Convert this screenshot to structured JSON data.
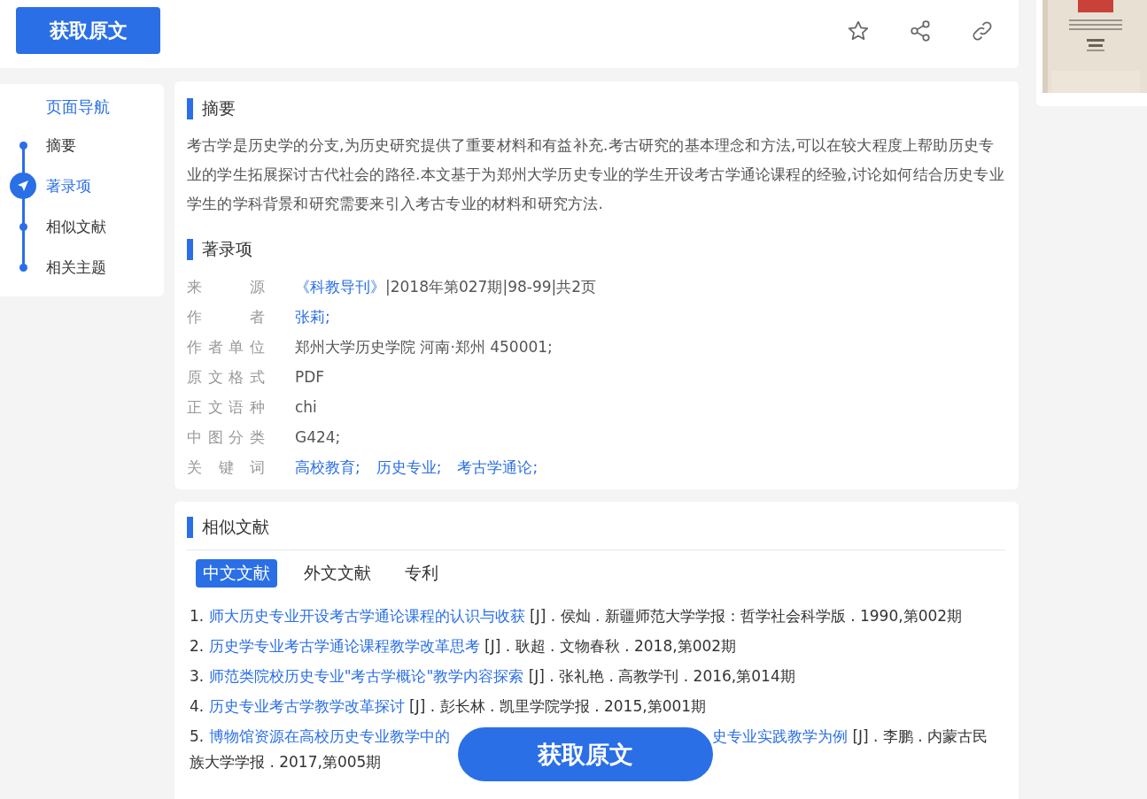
{
  "header": {
    "button": "获取原文"
  },
  "nav": {
    "title": "页面导航",
    "items": [
      {
        "label": "摘要",
        "selected": false
      },
      {
        "label": "著录项",
        "selected": true
      },
      {
        "label": "相似文献",
        "selected": false
      },
      {
        "label": "相关主题",
        "selected": false
      }
    ]
  },
  "abstract": {
    "heading": "摘要",
    "text": "考古学是历史学的分支,为历史研究提供了重要材料和有益补充.考古研究的基本理念和方法,可以在较大程度上帮助历史专业的学生拓展探讨古代社会的路径.本文基于为郑州大学历史专业的学生开设考古学通论课程的经验,讨论如何结合历史专业学生的学科背景和研究需要来引入考古专业的材料和研究方法."
  },
  "record": {
    "heading": "著录项",
    "fields": [
      {
        "label": "来源",
        "parts": [
          {
            "text": "《科教导刊》",
            "kind": "link"
          },
          {
            "text": "|2018年第027期|98-99|共2页",
            "kind": "text"
          }
        ]
      },
      {
        "label": "作者",
        "parts": [
          {
            "text": "张莉;",
            "kind": "link"
          }
        ]
      },
      {
        "label": "作者单位",
        "parts": [
          {
            "text": "郑州大学历史学院 河南·郑州 450001;",
            "kind": "text"
          }
        ]
      },
      {
        "label": "原文格式",
        "parts": [
          {
            "text": "PDF",
            "kind": "text"
          }
        ]
      },
      {
        "label": "正文语种",
        "parts": [
          {
            "text": "chi",
            "kind": "text"
          }
        ]
      },
      {
        "label": "中图分类",
        "parts": [
          {
            "text": "G424;",
            "kind": "text"
          }
        ]
      },
      {
        "label": "关键词",
        "parts": [
          {
            "text": "高校教育;",
            "kind": "link"
          },
          {
            "text": "历史专业;",
            "kind": "link"
          },
          {
            "text": "考古学通论;",
            "kind": "link"
          }
        ]
      }
    ]
  },
  "similar": {
    "heading": "相似文献",
    "tabs": [
      {
        "label": "中文文献",
        "selected": true
      },
      {
        "label": "外文文献",
        "selected": false
      },
      {
        "label": "专利",
        "selected": false
      }
    ],
    "items": [
      {
        "number": "1.",
        "title": "师大历史专业开设考古学通论课程的认识与收获",
        "info": "[J] . 侯灿 . 新疆师范大学学报：哲学社会科学版 . 1990,第002期"
      },
      {
        "number": "2.",
        "title": "历史学专业考古学通论课程教学改革思考",
        "info": "[J] . 耿超 . 文物春秋 . 2018,第002期"
      },
      {
        "number": "3.",
        "title": "师范类院校历史专业\"考古学概论\"教学内容探索",
        "info": "[J] . 张礼艳 . 高教学刊 . 2016,第014期"
      },
      {
        "number": "4.",
        "title": "历史专业考古学教学改革探讨",
        "info": "[J] . 彭长林 . 凯里学院学报 . 2015,第001期"
      },
      {
        "number": "5.",
        "title": "博物馆资源在高校历史专业教学中的",
        "title_end": "史专业实践教学为例",
        "info": "[J] . 李鹏 . 内蒙古民",
        "info_end": "族大学学报 . 2017,第005期"
      }
    ]
  },
  "floating_button": "获取原文"
}
